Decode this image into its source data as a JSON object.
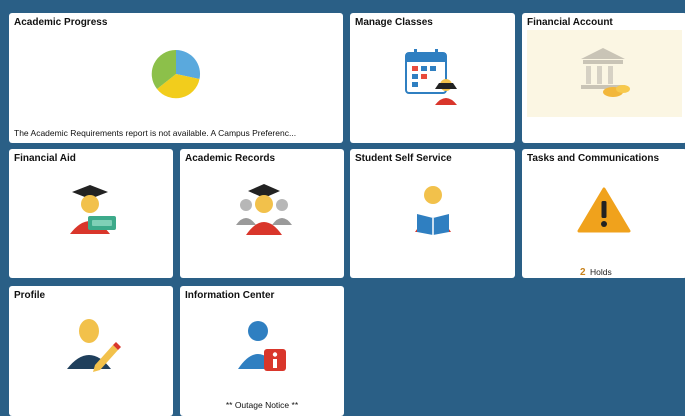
{
  "tiles": {
    "academic_progress": {
      "title": "Academic Progress",
      "note": "The Academic Requirements report is not available.  A Campus Preferenc..."
    },
    "manage_classes": {
      "title": "Manage Classes"
    },
    "financial_account": {
      "title": "Financial Account"
    },
    "financial_aid": {
      "title": "Financial Aid"
    },
    "academic_records": {
      "title": "Academic Records"
    },
    "student_self_service": {
      "title": "Student Self Service"
    },
    "tasks_communications": {
      "title": "Tasks and Communications",
      "holds_count": "2",
      "holds_label": "Holds"
    },
    "profile": {
      "title": "Profile"
    },
    "information_center": {
      "title": "Information Center",
      "note": "** Outage Notice **"
    }
  },
  "icons": {
    "academic_progress": "pie-chart-icon",
    "manage_classes": "calendar-graduate-icon",
    "financial_account": "bank-coins-icon",
    "financial_aid": "graduate-money-icon",
    "academic_records": "graduates-group-icon",
    "student_self_service": "student-reading-icon",
    "tasks_communications": "warning-icon",
    "profile": "person-edit-icon",
    "information_center": "person-info-icon"
  },
  "colors": {
    "background": "#2a5f86",
    "tile": "#ffffff",
    "warning": "#f0a21c",
    "info_badge": "#d9362b"
  }
}
